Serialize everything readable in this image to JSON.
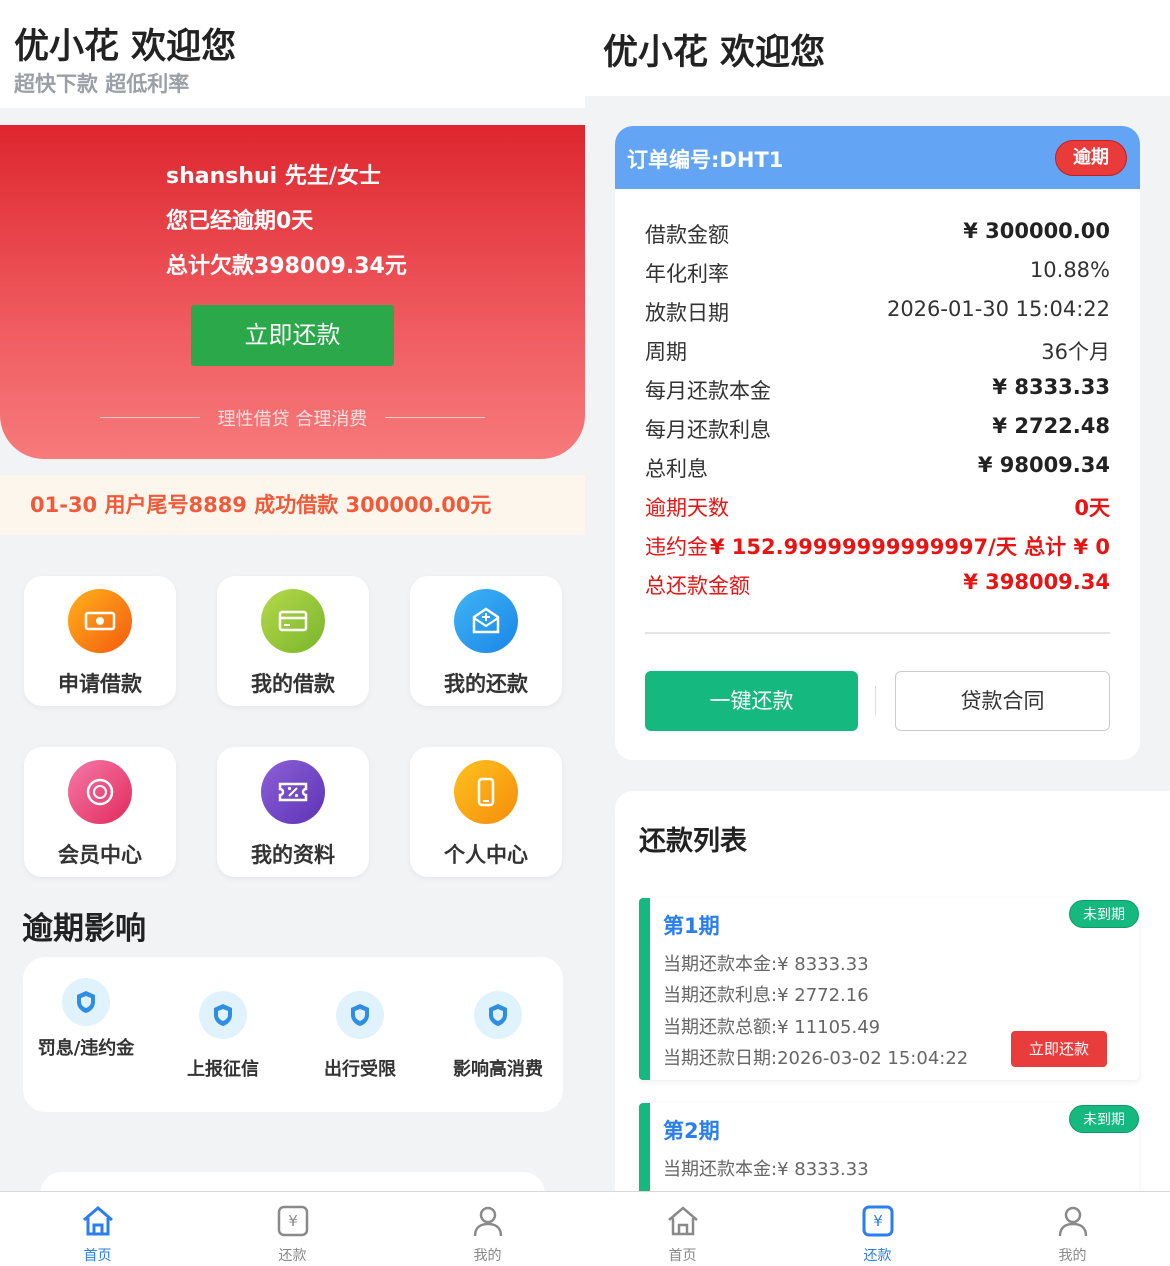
{
  "left": {
    "header": {
      "title": "优小花 欢迎您",
      "subtitle": "超快下款 超低利率"
    },
    "hero": {
      "greeting": "shanshui 先生/女士",
      "overdue": "您已经逾期0天",
      "total_debt": "总计欠款398009.34元",
      "repay_button": "立即还款",
      "slogan": "理性借贷 合理消费"
    },
    "notice": "01-30 用户尾号8889 成功借款 300000.00元",
    "tiles": [
      {
        "label": "申请借款",
        "icon": "cash-icon"
      },
      {
        "label": "我的借款",
        "icon": "card-icon"
      },
      {
        "label": "我的还款",
        "icon": "envelope-icon"
      },
      {
        "label": "会员中心",
        "icon": "coin-icon"
      },
      {
        "label": "我的资料",
        "icon": "ticket-icon"
      },
      {
        "label": "个人中心",
        "icon": "phone-icon"
      }
    ],
    "impact": {
      "title": "逾期影响",
      "items": [
        {
          "label": "罚息/违约金"
        },
        {
          "label": "上报征信"
        },
        {
          "label": "出行受限"
        },
        {
          "label": "影响高消费"
        }
      ]
    },
    "tabbar": {
      "home": "首页",
      "repay": "还款",
      "mine": "我的",
      "active": "home"
    }
  },
  "right": {
    "header": {
      "title": "优小花 欢迎您"
    },
    "order": {
      "number": "订单编号:DHT1",
      "status": "逾期",
      "rows": [
        {
          "key": "借款金额",
          "value": "¥ 300000.00"
        },
        {
          "key": "年化利率",
          "value": "10.88%"
        },
        {
          "key": "放款日期",
          "value": "2026-01-30 15:04:22"
        },
        {
          "key": "周期",
          "value": "36个月"
        },
        {
          "key": "每月还款本金",
          "value": "¥ 8333.33"
        },
        {
          "key": "每月还款利息",
          "value": "¥ 2722.48"
        },
        {
          "key": "总利息",
          "value": "¥ 98009.34"
        },
        {
          "key": "逾期天数",
          "value": "0天"
        },
        {
          "key": "违约金",
          "value": "¥ 152.99999999999997/天 总计 ¥ 0"
        },
        {
          "key": "总还款金额",
          "value": "¥ 398009.34"
        }
      ],
      "repay_button": "一键还款",
      "contract_button": "贷款合同"
    },
    "repay_list": {
      "title": "还款列表",
      "periods": [
        {
          "name": "第1期",
          "status": "未到期",
          "principal": "当期还款本金:¥ 8333.33",
          "interest": "当期还款利息:¥ 2772.16",
          "total": "当期还款总额:¥ 11105.49",
          "date": "当期还款日期:2026-03-02 15:04:22",
          "button": "立即还款"
        },
        {
          "name": "第2期",
          "status": "未到期",
          "principal": "当期还款本金:¥ 8333.33"
        }
      ]
    },
    "tabbar": {
      "home": "首页",
      "repay": "还款",
      "mine": "我的",
      "active": "repay"
    }
  },
  "colors": {
    "hero_red": "#de262e",
    "repay_green": "#2aa84a",
    "teal": "#15b87f",
    "tab_active": "#2a7ef0",
    "header_blue": "#64a4f5",
    "danger_red": "#e81414"
  }
}
